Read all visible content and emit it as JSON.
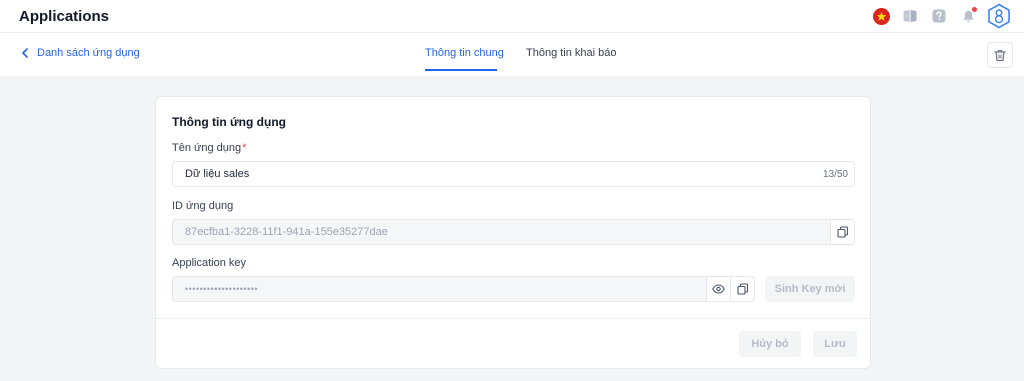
{
  "header": {
    "title": "Applications"
  },
  "subnav": {
    "back_label": "Danh sách ứng dụng",
    "tabs": [
      {
        "label": "Thông tin chung",
        "active": true
      },
      {
        "label": "Thông tin khai báo",
        "active": false
      }
    ]
  },
  "form": {
    "section_title": "Thông tin ứng dụng",
    "app_name": {
      "label": "Tên ứng dụng",
      "required_mark": "*",
      "value": "Dữ liệu sales",
      "counter": "13/50"
    },
    "app_id": {
      "label": "ID ứng dụng",
      "value": "87ecfba1-3228-11f1-941a-155e35277dae"
    },
    "app_key": {
      "label": "Application key",
      "masked_value": "••••••••••••••••••••",
      "generate_label": "Sinh Key mới"
    },
    "actions": {
      "cancel_label": "Hủy bỏ",
      "save_label": "Lưu"
    }
  },
  "colors": {
    "accent": "#2563eb",
    "flag_red": "#da251d",
    "flag_star": "#ffdd00",
    "notification": "#ef4444"
  },
  "icons": {
    "language": "vietnam-flag-icon",
    "guide": "book-icon",
    "help": "help-icon",
    "notifications": "bell-icon",
    "user": "avatar-icon",
    "back": "chevron-left-icon",
    "delete": "trash-icon",
    "copy": "copy-icon",
    "reveal": "eye-icon"
  }
}
